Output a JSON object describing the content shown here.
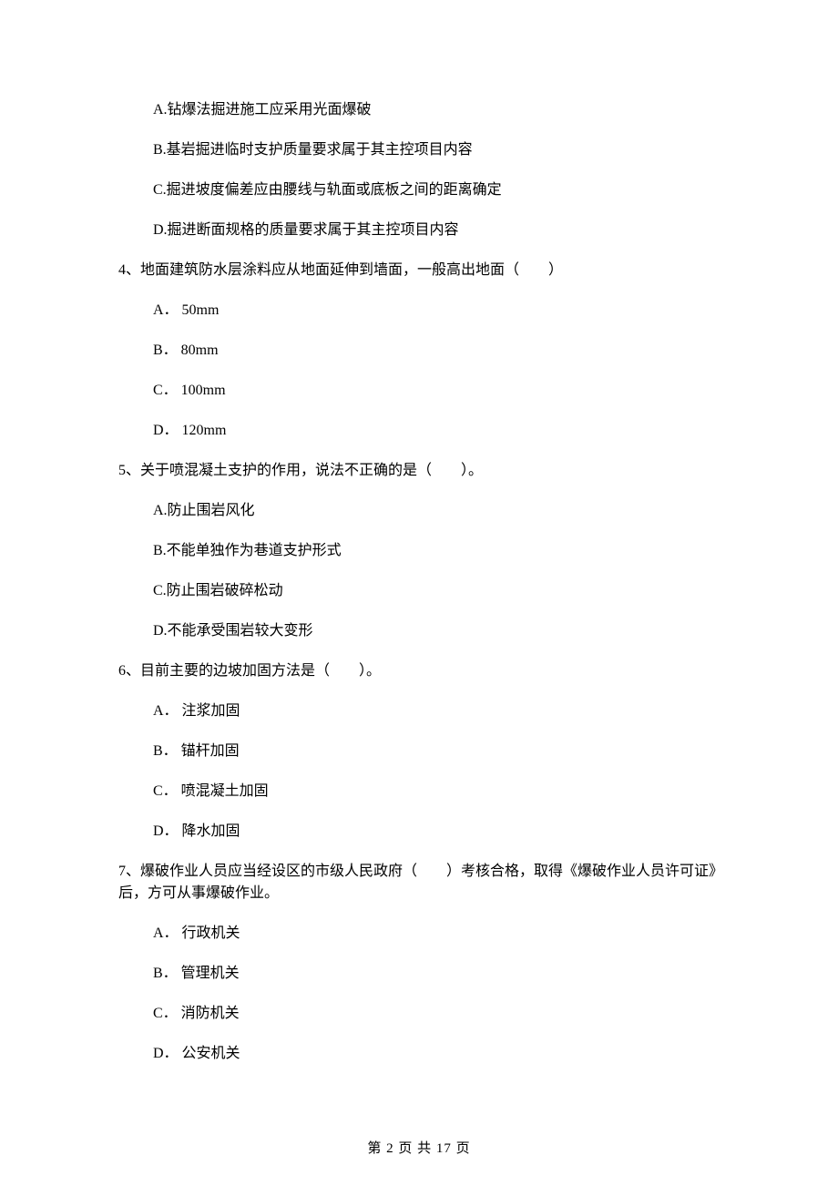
{
  "q3_options": {
    "A": "A.钻爆法掘进施工应采用光面爆破",
    "B": "B.基岩掘进临时支护质量要求属于其主控项目内容",
    "C": "C.掘进坡度偏差应由腰线与轨面或底板之间的距离确定",
    "D": "D.掘进断面规格的质量要求属于其主控项目内容"
  },
  "q4": {
    "stem": "4、地面建筑防水层涂料应从地面延伸到墙面，一般高出地面（　　）",
    "options": {
      "A": "A． 50mm",
      "B": "B． 80mm",
      "C": "C． 100mm",
      "D": "D． 120mm"
    }
  },
  "q5": {
    "stem": "5、关于喷混凝土支护的作用，说法不正确的是（　　）。",
    "options": {
      "A": "A.防止围岩风化",
      "B": "B.不能单独作为巷道支护形式",
      "C": "C.防止围岩破碎松动",
      "D": "D.不能承受围岩较大变形"
    }
  },
  "q6": {
    "stem": "6、目前主要的边坡加固方法是（　　）。",
    "options": {
      "A": "A． 注浆加固",
      "B": "B． 锚杆加固",
      "C": "C． 喷混凝土加固",
      "D": "D． 降水加固"
    }
  },
  "q7": {
    "stem": "7、爆破作业人员应当经设区的市级人民政府（　　）考核合格，取得《爆破作业人员许可证》后，方可从事爆破作业。",
    "options": {
      "A": "A． 行政机关",
      "B": "B． 管理机关",
      "C": "C． 消防机关",
      "D": "D． 公安机关"
    }
  },
  "footer": "第 2 页 共 17 页"
}
